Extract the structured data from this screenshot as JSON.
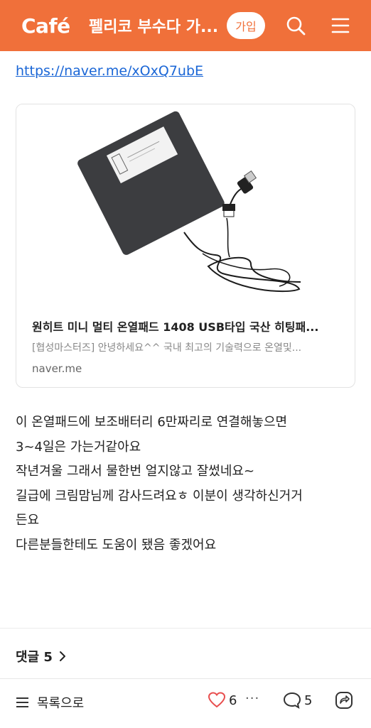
{
  "header": {
    "logo": "Café",
    "cafe_name": "펠리코 부수다 가...",
    "join_label": "가입",
    "icons": [
      "search-icon",
      "menu-icon"
    ],
    "accent_color": "#f0703a"
  },
  "post": {
    "link_url_text": "https://naver.me/xOxQ7ubE",
    "link_card": {
      "title": "원히트 미니 멀티 온열패드 1408 USB타입 국산 히팅패...",
      "description": "[협성마스터즈] 안녕하세요^^ 국내 최고의 기술력으로 온열및...",
      "domain": "naver.me"
    },
    "body_lines": [
      "이 온열패드에 보조배터리 6만짜리로 연결해놓으면",
      "3~4일은 가는거같아요",
      "작년겨울 그래서 물한번 얼지않고 잘썼네요~",
      "길급에 크림맘님께 감사드려요ㅎ 이분이 생각하신거거",
      "든요",
      "다른분들한테도 도움이 됐음 좋겠어요"
    ]
  },
  "comments": {
    "label": "댓글 5"
  },
  "bottom_bar": {
    "list_label": "목록으로",
    "like_count": "6",
    "more_label": "···",
    "comment_count": "5",
    "icons": [
      "list-icon",
      "heart-icon",
      "more-icon",
      "comment-icon",
      "share-icon"
    ]
  }
}
